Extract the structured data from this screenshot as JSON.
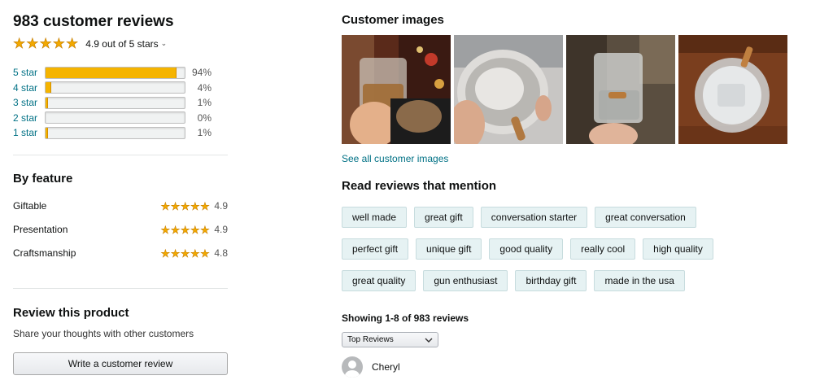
{
  "summary": {
    "title": "983 customer reviews",
    "rating_text": "4.9 out of 5 stars",
    "rating": 4.9,
    "star_color": "#f2a900"
  },
  "histogram": [
    {
      "label": "5 star",
      "percent": 94,
      "percent_text": "94%"
    },
    {
      "label": "4 star",
      "percent": 4,
      "percent_text": "4%"
    },
    {
      "label": "3 star",
      "percent": 1,
      "percent_text": "1%"
    },
    {
      "label": "2 star",
      "percent": 0,
      "percent_text": "0%"
    },
    {
      "label": "1 star",
      "percent": 1,
      "percent_text": "1%"
    }
  ],
  "by_feature": {
    "heading": "By feature",
    "items": [
      {
        "name": "Giftable",
        "rating": 4.9,
        "rating_text": "4.9"
      },
      {
        "name": "Presentation",
        "rating": 4.9,
        "rating_text": "4.9"
      },
      {
        "name": "Craftsmanship",
        "rating": 4.8,
        "rating_text": "4.8"
      }
    ]
  },
  "review_product": {
    "heading": "Review this product",
    "subtext": "Share your thoughts with other customers",
    "button_label": "Write a customer review"
  },
  "customer_images": {
    "heading": "Customer images",
    "images": [
      {
        "icon": "whiskey-glass-photo"
      },
      {
        "icon": "glass-closeup-photo"
      },
      {
        "icon": "glass-with-bullet-photo"
      },
      {
        "icon": "glass-topdown-photo"
      }
    ],
    "see_all_label": "See all customer images"
  },
  "mentions": {
    "heading": "Read reviews that mention",
    "rows": [
      [
        "well made",
        "great gift",
        "conversation starter",
        "great conversation"
      ],
      [
        "perfect gift",
        "unique gift",
        "good quality",
        "really cool",
        "high quality"
      ],
      [
        "great quality",
        "gun enthusiast",
        "birthday gift",
        "made in the usa"
      ]
    ]
  },
  "reviews": {
    "showing_text": "Showing 1-8 of 983 reviews",
    "sort_selected": "Top Reviews",
    "first_reviewer": "Cheryl"
  },
  "colors": {
    "link": "#007185",
    "bar_fill": "#f5b400",
    "chip_bg": "#e6f2f3"
  }
}
